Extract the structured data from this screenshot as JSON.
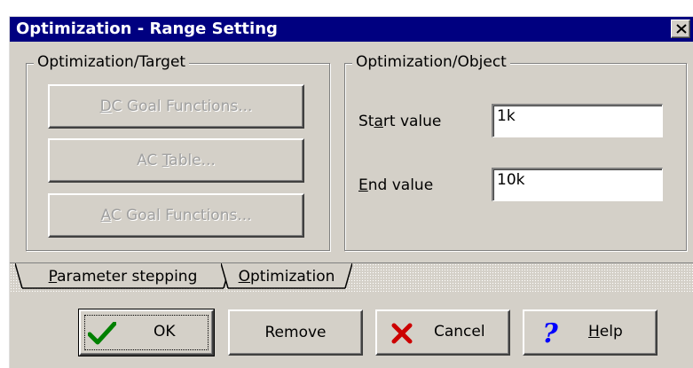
{
  "window": {
    "title": "Optimization - Range Setting"
  },
  "target_group": {
    "legend": "Optimization/Target",
    "buttons": [
      {
        "before": "",
        "mnemonic": "D",
        "after": "C Goal Functions...",
        "enabled": false
      },
      {
        "before": "AC ",
        "mnemonic": "T",
        "after": "able...",
        "enabled": false
      },
      {
        "before": "",
        "mnemonic": "A",
        "after": "C Goal Functions...",
        "enabled": false
      }
    ]
  },
  "object_group": {
    "legend": "Optimization/Object",
    "start": {
      "before": "St",
      "mnemonic": "a",
      "after": "rt value",
      "value": "1k"
    },
    "end": {
      "before": "",
      "mnemonic": "E",
      "after": "nd value",
      "value": "10k"
    }
  },
  "tabs": [
    {
      "before": "",
      "mnemonic": "P",
      "after": "arameter stepping",
      "active": false
    },
    {
      "before": "",
      "mnemonic": "O",
      "after": "ptimization",
      "active": true
    }
  ],
  "buttons": {
    "ok": {
      "label": "OK",
      "icon": "checkmark-icon",
      "icon_color": "#008000"
    },
    "remove": {
      "label": "Remove"
    },
    "cancel": {
      "label": "Cancel",
      "icon": "cross-icon",
      "icon_color": "#cc0000"
    },
    "help": {
      "before": "",
      "mnemonic": "H",
      "after": "elp",
      "icon": "question-mark-icon",
      "icon_color": "#0000ff"
    }
  }
}
